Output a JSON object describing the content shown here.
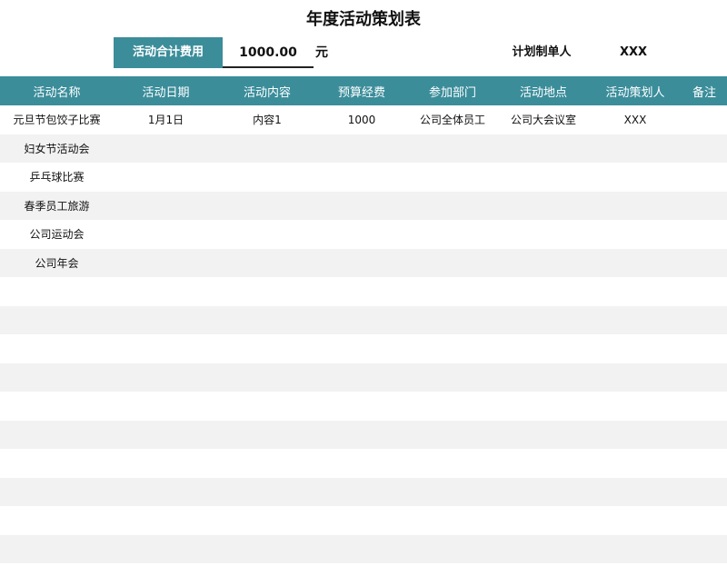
{
  "title": "年度活动策划表",
  "summary": {
    "total_label": "活动合计费用",
    "total_value": "1000.00",
    "unit": "元",
    "planner_label": "计划制单人",
    "planner_value": "XXX"
  },
  "colors": {
    "header_bg": "#3b8d9a",
    "header_text": "#ffffff",
    "stripe": "#f2f2f2"
  },
  "table": {
    "columns": [
      "活动名称",
      "活动日期",
      "活动内容",
      "预算经费",
      "参加部门",
      "活动地点",
      "活动策划人",
      "备注"
    ],
    "rows": [
      [
        "元旦节包饺子比赛",
        "1月1日",
        "内容1",
        "1000",
        "公司全体员工",
        "公司大会议室",
        "XXX",
        ""
      ],
      [
        "妇女节活动会",
        "",
        "",
        "",
        "",
        "",
        "",
        ""
      ],
      [
        "乒乓球比赛",
        "",
        "",
        "",
        "",
        "",
        "",
        ""
      ],
      [
        "春季员工旅游",
        "",
        "",
        "",
        "",
        "",
        "",
        ""
      ],
      [
        "公司运动会",
        "",
        "",
        "",
        "",
        "",
        "",
        ""
      ],
      [
        "公司年会",
        "",
        "",
        "",
        "",
        "",
        "",
        ""
      ],
      [
        "",
        "",
        "",
        "",
        "",
        "",
        "",
        ""
      ],
      [
        "",
        "",
        "",
        "",
        "",
        "",
        "",
        ""
      ],
      [
        "",
        "",
        "",
        "",
        "",
        "",
        "",
        ""
      ],
      [
        "",
        "",
        "",
        "",
        "",
        "",
        "",
        ""
      ],
      [
        "",
        "",
        "",
        "",
        "",
        "",
        "",
        ""
      ],
      [
        "",
        "",
        "",
        "",
        "",
        "",
        "",
        ""
      ],
      [
        "",
        "",
        "",
        "",
        "",
        "",
        "",
        ""
      ],
      [
        "",
        "",
        "",
        "",
        "",
        "",
        "",
        ""
      ],
      [
        "",
        "",
        "",
        "",
        "",
        "",
        "",
        ""
      ],
      [
        "",
        "",
        "",
        "",
        "",
        "",
        "",
        ""
      ]
    ]
  }
}
